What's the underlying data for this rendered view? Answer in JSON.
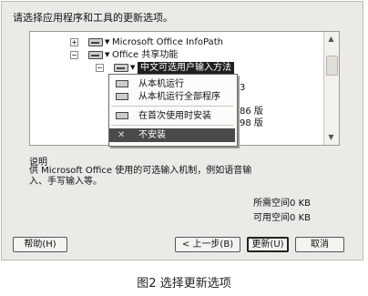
{
  "instruction": "请选择应用程序和工具的更新选项。",
  "tree": {
    "items": [
      {
        "label": "Microsoft Office InfoPath",
        "expander": "+"
      },
      {
        "label": "Office 共享功能",
        "expander": "−"
      },
      {
        "label": "中文可选用户输入方法",
        "expander": "−"
      }
    ],
    "partial_texts": [
      "3",
      "86 版",
      "98 版"
    ]
  },
  "context_menu": {
    "items": [
      {
        "label": "从本机运行",
        "icon": "drive-icon"
      },
      {
        "label": "从本机运行全部程序",
        "icon": "drive-icon"
      },
      {
        "label": "在首次使用时安装",
        "icon": "drive-icon"
      },
      {
        "label": "不安装",
        "icon": "x-icon",
        "selected": true
      }
    ]
  },
  "description": {
    "title": "说明",
    "body": "供 Microsoft Office 使用的可选输入机制，例如语音输入、手写输入等。"
  },
  "space": {
    "required": "所需空间0 KB",
    "available": "可用空间0 KB"
  },
  "buttons": {
    "help": "帮助(H)",
    "back": "< 上一步(B)",
    "update": "更新(U)",
    "cancel": "取消"
  },
  "caption": "图2 选择更新选项"
}
